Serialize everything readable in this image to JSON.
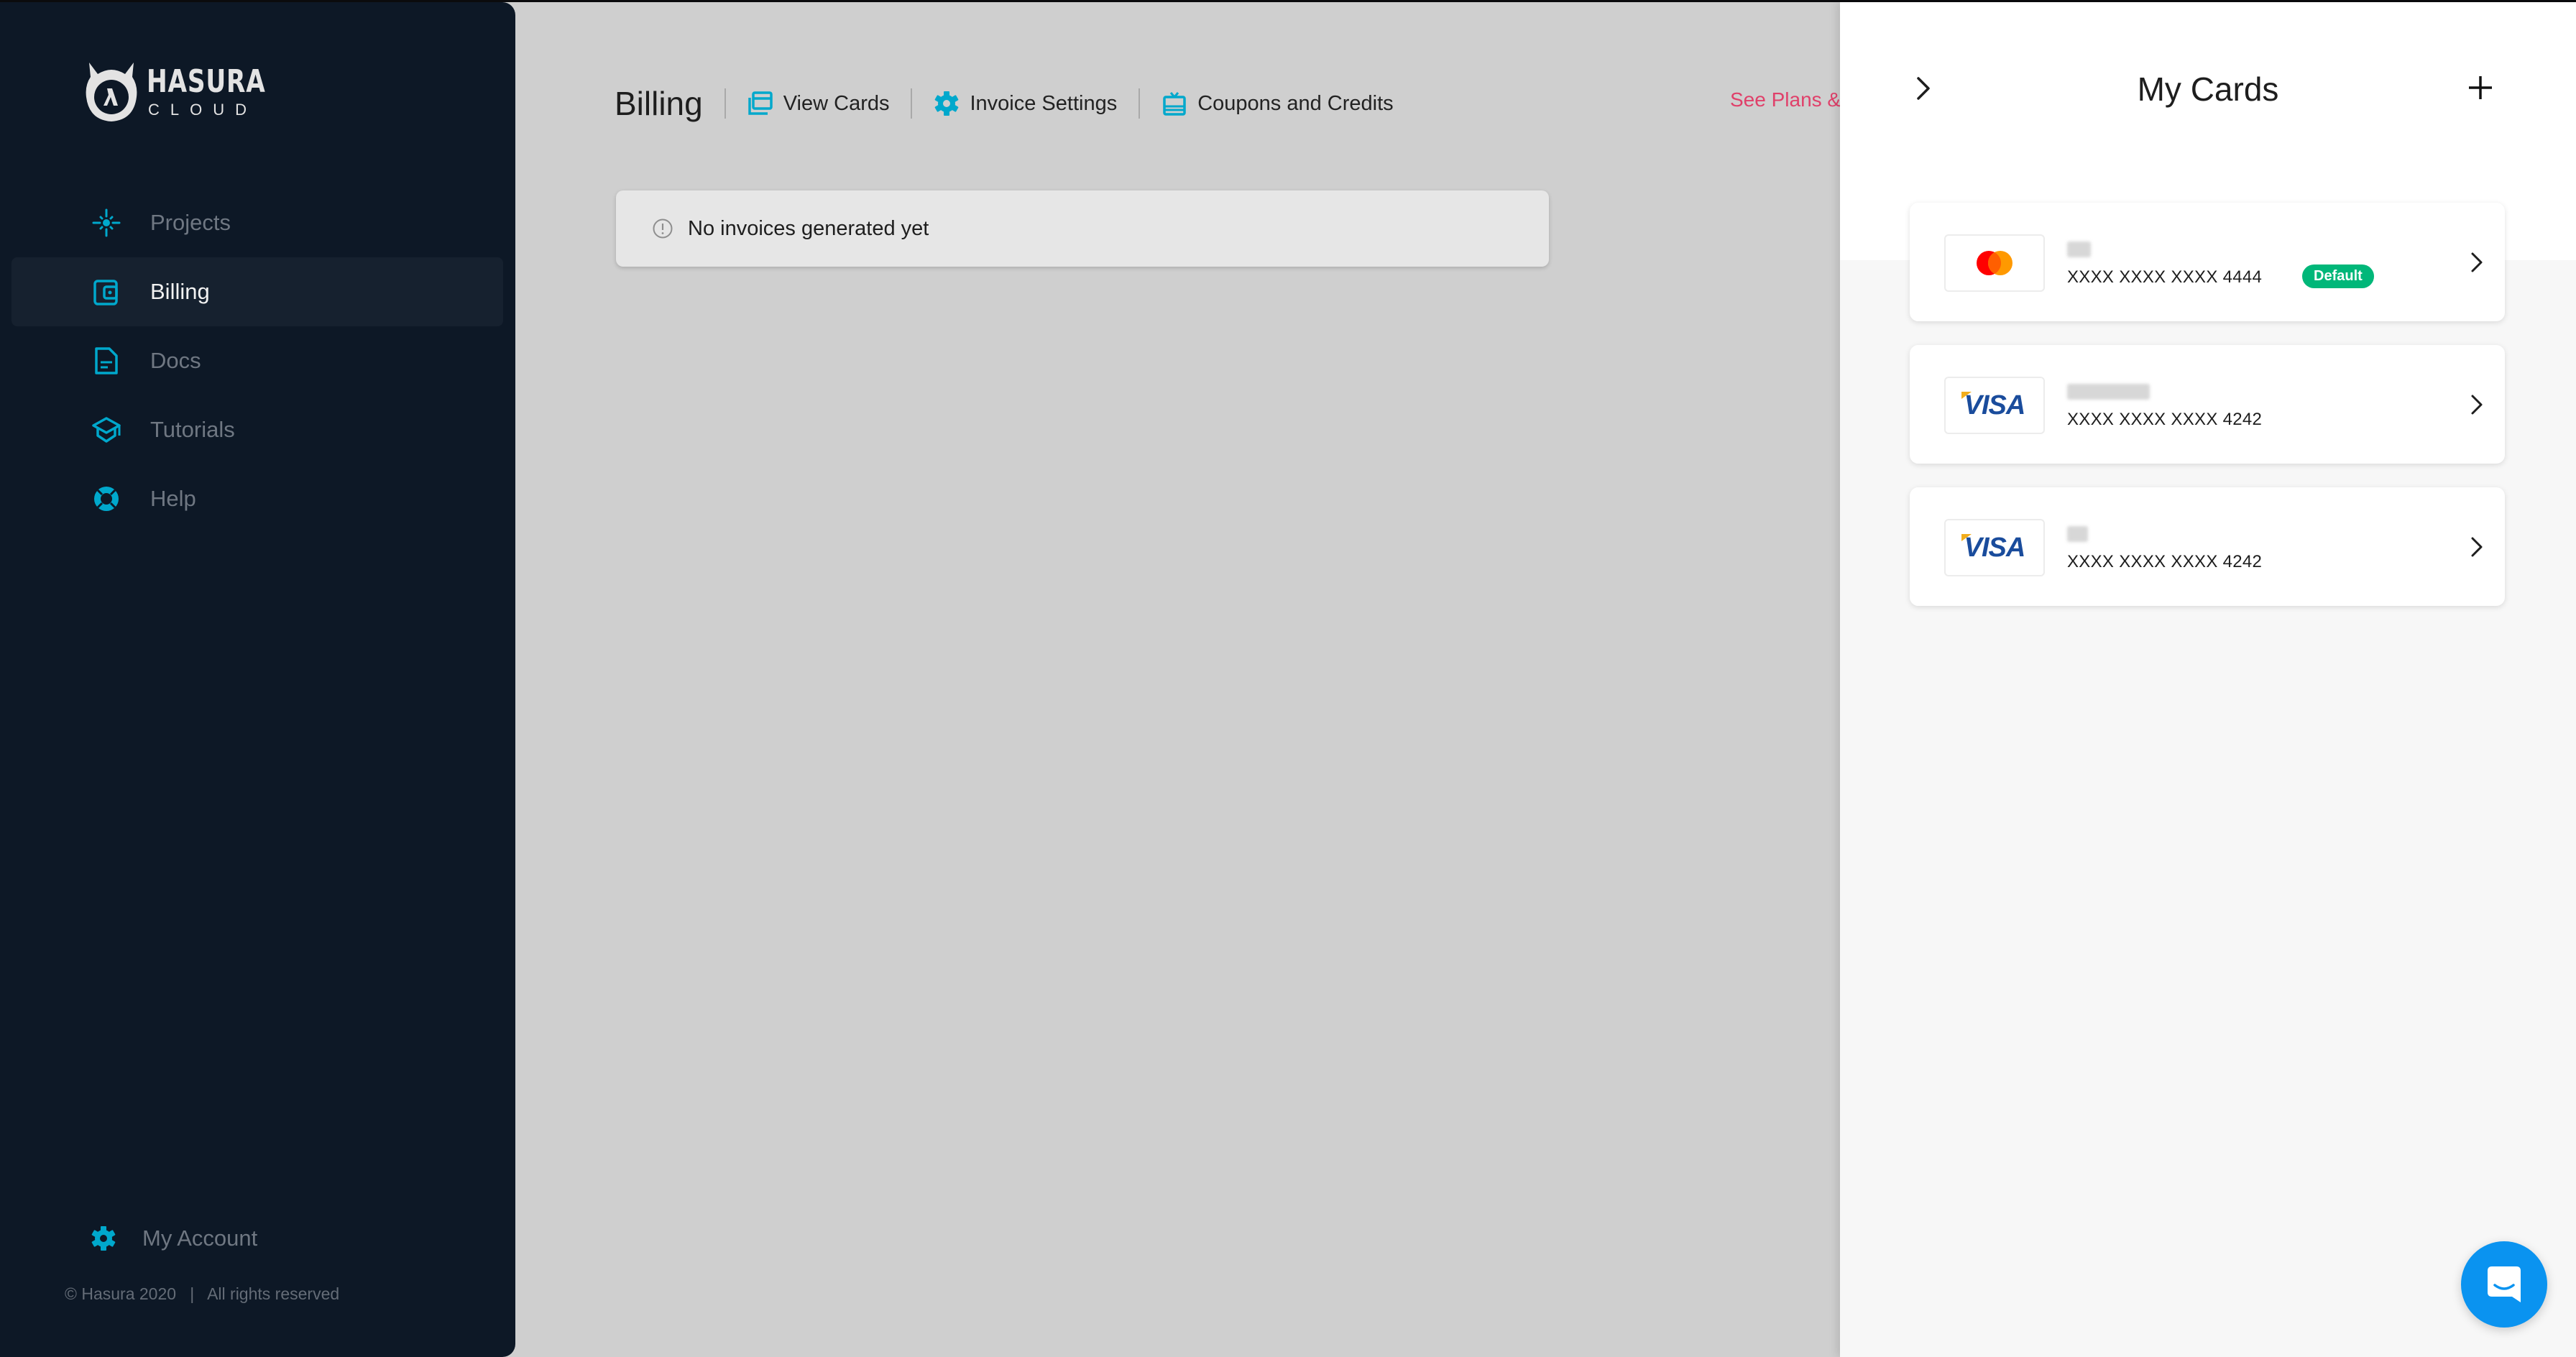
{
  "brand": {
    "name": "HASURA",
    "sub": "CLOUD"
  },
  "sidebar": {
    "items": [
      {
        "label": "Projects",
        "icon": "projects-icon",
        "active": false
      },
      {
        "label": "Billing",
        "icon": "wallet-icon",
        "active": true
      },
      {
        "label": "Docs",
        "icon": "document-icon",
        "active": false
      },
      {
        "label": "Tutorials",
        "icon": "graduation-cap-icon",
        "active": false
      },
      {
        "label": "Help",
        "icon": "lifebuoy-icon",
        "active": false
      }
    ],
    "account_label": "My Account",
    "footer": "© Hasura 2020   |   All rights reserved"
  },
  "header": {
    "title": "Billing",
    "nav": [
      {
        "label": "View Cards",
        "icon": "cards-icon"
      },
      {
        "label": "Invoice Settings",
        "icon": "gear-icon"
      },
      {
        "label": "Coupons and Credits",
        "icon": "gift-card-icon"
      }
    ],
    "see_plans": "See Plans &"
  },
  "alert": {
    "text": "No invoices generated yet",
    "icon": "info-icon"
  },
  "drawer": {
    "title": "My Cards",
    "cards": [
      {
        "brand": "mastercard",
        "name": "Test",
        "number": "XXXX XXXX XXXX 4444",
        "badge": "Default"
      },
      {
        "brand": "visa",
        "name": "test@example",
        "number": "XXXX XXXX XXXX 4242",
        "badge": null
      },
      {
        "brand": "visa",
        "name": "test",
        "number": "XXXX XXXX XXXX 4242",
        "badge": null
      }
    ],
    "visa_label": "VISA"
  },
  "colors": {
    "sidebar_bg": "#0d1826",
    "accent": "#00a8cc",
    "link_red": "#e0406a",
    "default_badge": "#00b779",
    "chat_blue": "#0a93f0"
  }
}
